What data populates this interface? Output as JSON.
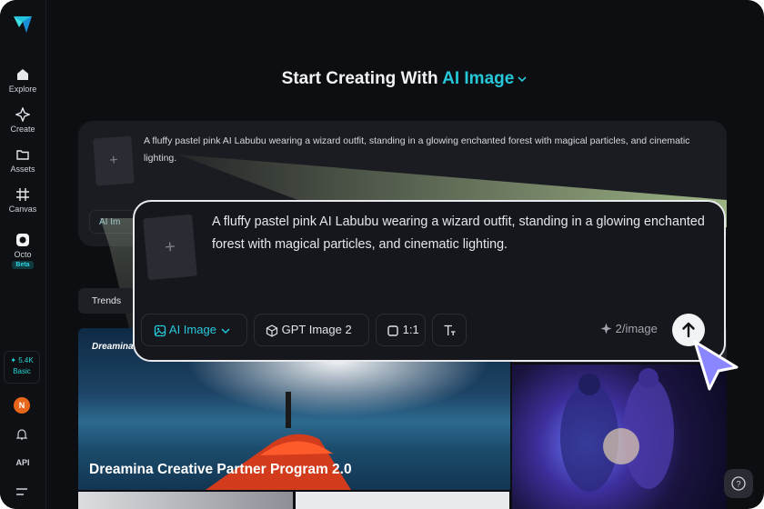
{
  "sidebar": {
    "items": [
      {
        "label": "Explore",
        "icon": "home-icon"
      },
      {
        "label": "Create",
        "icon": "sparkle-icon"
      },
      {
        "label": "Assets",
        "icon": "folder-icon"
      },
      {
        "label": "Canvas",
        "icon": "canvas-icon"
      },
      {
        "label": "Octo",
        "icon": "octo-icon",
        "badge": "Beta"
      }
    ],
    "credits": {
      "amount": "5.4K",
      "plan": "Basic"
    },
    "avatar_initial": "N",
    "api_label": "API"
  },
  "header": {
    "title_prefix": "Start Creating With",
    "title_mode": "AI Image"
  },
  "background_prompt": {
    "text": "A fluffy pastel pink AI Labubu wearing a wizard outfit, standing in a glowing enchanted forest with magical particles, and cinematic lighting.",
    "chip_label": "AI Im"
  },
  "trends_tab": "Trends",
  "gallery": {
    "main_caption": "Dreamina Creative Partner Program 2.0",
    "main_brand": "Dreamina"
  },
  "prompt_panel": {
    "thumbnail_placeholder": "+",
    "text": "A fluffy pastel pink AI Labubu wearing a wizard outfit, standing in a glowing enchanted forest with magical particles, and cinematic lighting.",
    "mode_label": "AI Image",
    "model_label": "GPT Image 2",
    "ratio_label": "1:1",
    "cost_label": "2/image"
  },
  "colors": {
    "accent": "#25c7d8",
    "background": "#0d0e12",
    "panel": "#16171c",
    "cursor": "#8a86ff"
  }
}
